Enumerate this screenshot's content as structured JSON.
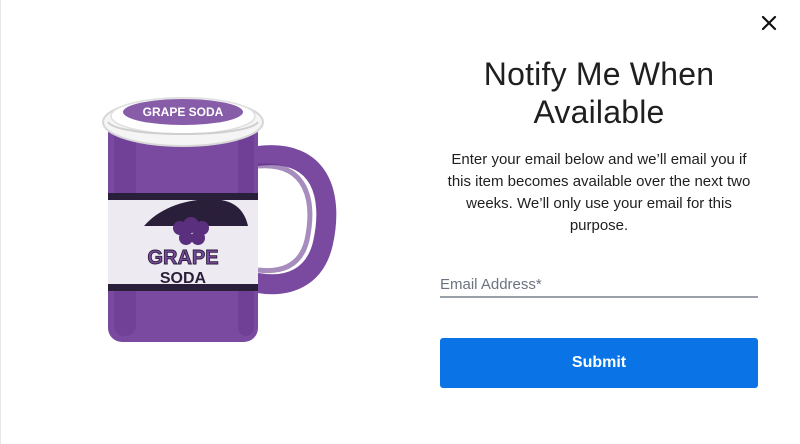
{
  "modal": {
    "title": "Notify Me When Available",
    "description": "Enter your email below and we’ll email you if this item becomes available over the next two weeks. We’ll only use your email for this purpose.",
    "email_placeholder": "Email Address*",
    "submit_label": "Submit",
    "close_icon": "close-icon"
  },
  "product": {
    "image_icon": "grape-soda-mug",
    "label_top": "GRAPE",
    "label_bottom": "SODA",
    "lid_text": "GRAPE SODA",
    "colors": {
      "body_purple": "#7a4aa0",
      "label_white": "#eeeaf1",
      "lid_white": "#f5f5f5",
      "band_dark": "#2a1f3a"
    }
  },
  "colors": {
    "primary": "#0a74e6",
    "text": "#1f1f1f",
    "input_border": "#9aa0a8"
  }
}
